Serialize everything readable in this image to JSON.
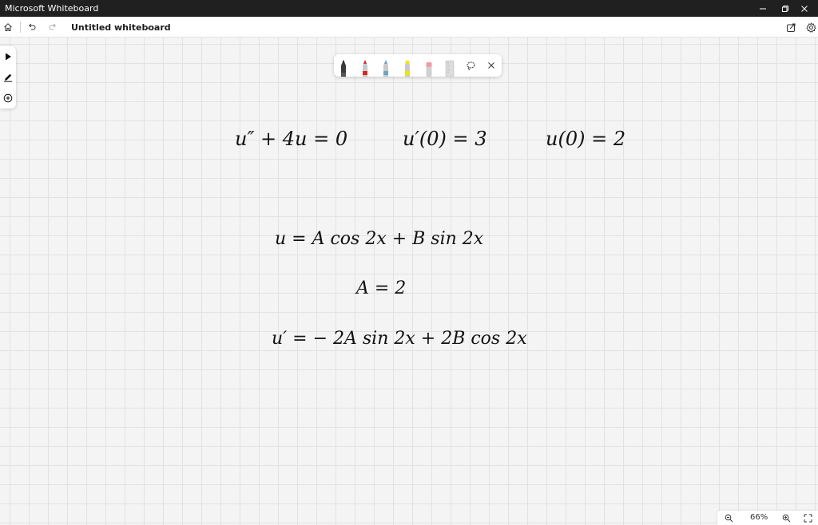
{
  "window": {
    "app_title": "Microsoft Whiteboard"
  },
  "header": {
    "doc_title": "Untitled whiteboard"
  },
  "pen_toolbar": {
    "pens": [
      {
        "name": "black-pen",
        "color": "#1a1a1a"
      },
      {
        "name": "red-pen",
        "color": "#d42a2a"
      },
      {
        "name": "blue-pen",
        "color": "#6aa4c8"
      },
      {
        "name": "yellow-highlighter",
        "color": "#f2e600"
      },
      {
        "name": "pink-eraser",
        "color": "#f29aa8"
      },
      {
        "name": "ruler",
        "color": "#d8d8d8"
      }
    ]
  },
  "ink": {
    "line1_eq": "u″ + 4u = 0",
    "line1_cond1": "u′(0) = 3",
    "line1_cond2": "u(0) = 2",
    "line2": "u =  A cos 2x  + B sin 2x",
    "line3": "A = 2",
    "line4": "u′ =  − 2A sin 2x  + 2B cos 2x"
  },
  "zoom": {
    "value": "66%"
  }
}
